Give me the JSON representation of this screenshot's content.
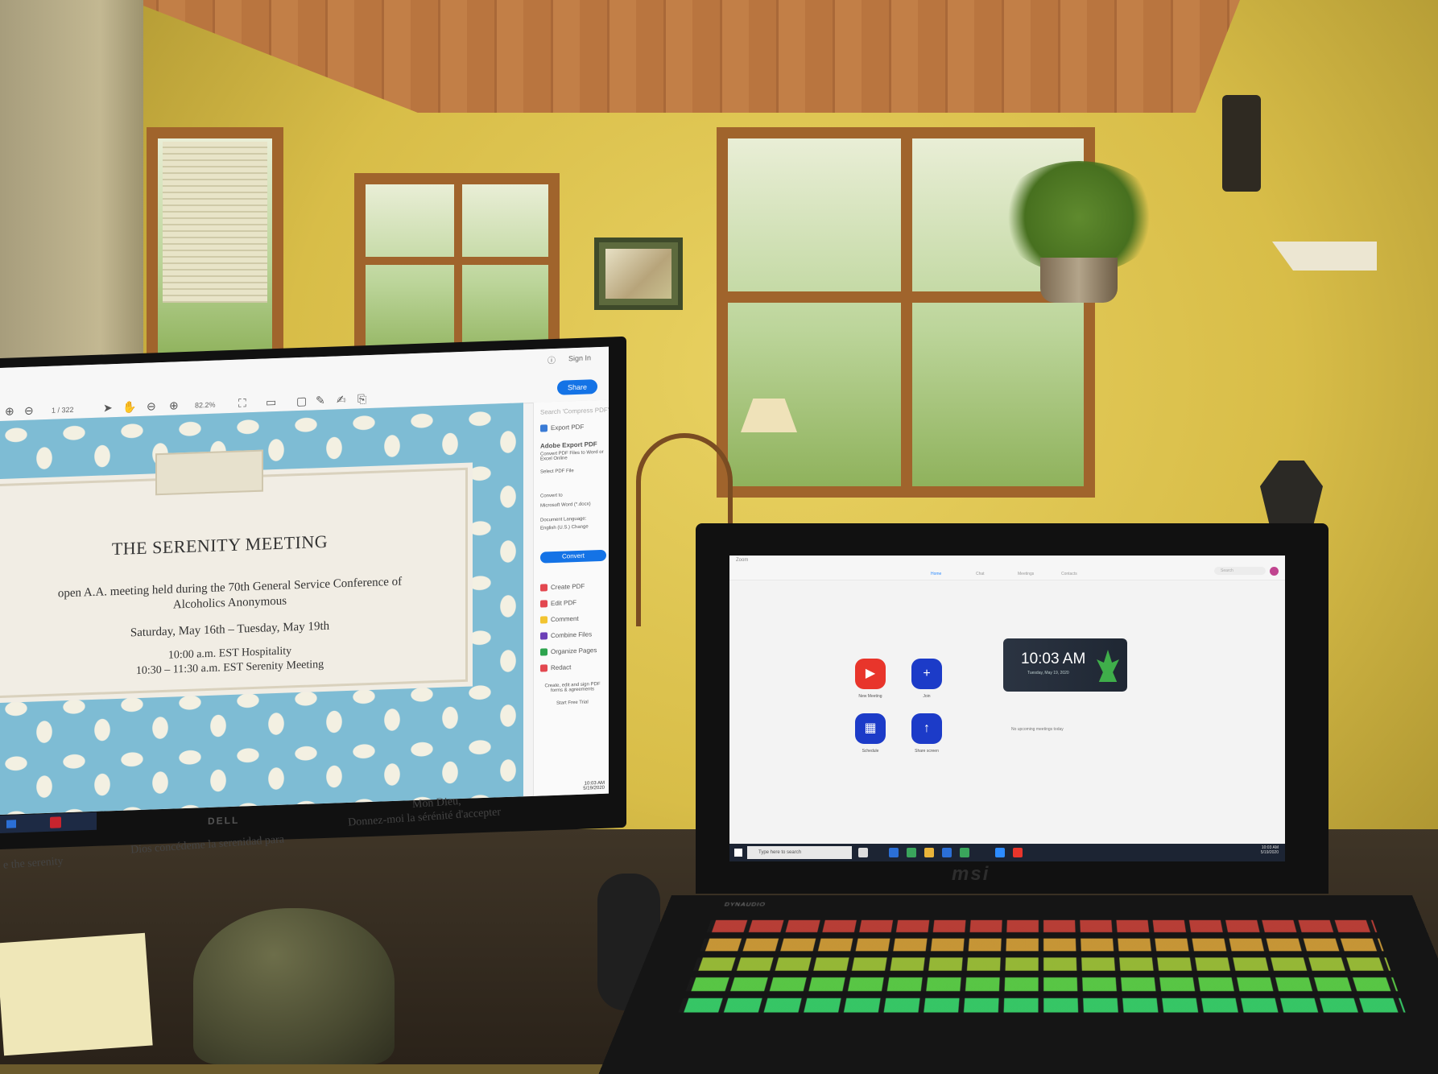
{
  "acrobat": {
    "sign_in": "Sign In",
    "share": "Share",
    "page_indicator": "1 / 322",
    "zoom": "82.2%",
    "panel": {
      "search": "Search 'Compress PDF'",
      "export_pdf": "Export PDF",
      "adobe_export": "Adobe Export PDF",
      "convert_desc": "Convert PDF Files to Word or Excel Online",
      "select_file": "Select PDF File",
      "convert_to": "Convert to",
      "format": "Microsoft Word (*.docx)",
      "doc_language": "Document Language:",
      "language": "English (U.S.) Change",
      "convert": "Convert",
      "create_pdf": "Create PDF",
      "edit_pdf": "Edit PDF",
      "comment": "Comment",
      "combine": "Combine Files",
      "organize": "Organize Pages",
      "redact": "Redact",
      "promo": "Create, edit and sign PDF forms & agreements",
      "trial": "Start Free Trial"
    },
    "clock": {
      "time": "10:03 AM",
      "date": "5/19/2020"
    }
  },
  "document": {
    "title": "THE SERENITY MEETING",
    "line1": "open A.A. meeting held during the 70th General Service Conference of",
    "line2": "Alcoholics Anonymous",
    "line3": "Saturday, May 16th – Tuesday, May 19th",
    "line4": "10:00 a.m. EST Hospitality",
    "line5": "10:30 – 11:30 a.m. EST Serenity Meeting",
    "prayer_en": "e the serenity",
    "prayer_es": "Dios concédeme la serenidad para",
    "prayer_fr1": "Mon Dieu,",
    "prayer_fr2": "Donnez-moi la sérénité d'accepter"
  },
  "monitor_brand": "DELL",
  "zoom": {
    "app_name": "Zoom",
    "tabs": [
      "Home",
      "Chat",
      "Meetings",
      "Contacts"
    ],
    "search": "Search",
    "buttons": {
      "new_meeting": "New Meeting",
      "join": "Join",
      "schedule": "Schedule",
      "share_screen": "Share screen"
    },
    "clock": {
      "time": "10:03 AM",
      "date": "Tuesday, May 19, 2020"
    },
    "no_meetings": "No upcoming meetings today",
    "taskbar_search": "Type here to search",
    "tray": {
      "time": "10:03 AM",
      "date": "5/19/2020"
    },
    "colors": {
      "new_meeting": "#e8352b",
      "blue": "#1c3bc8"
    }
  },
  "laptop_brand": "msi",
  "speaker_brand": "DYNAUDIO"
}
